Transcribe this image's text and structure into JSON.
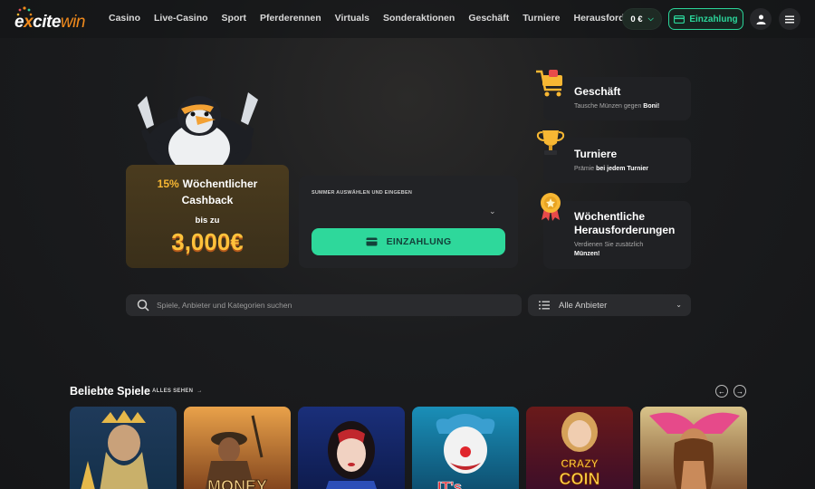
{
  "header": {
    "logo": {
      "part1": "e",
      "part2": "x",
      "part3": "cite",
      "part4": "win"
    },
    "nav": [
      "Casino",
      "Live-Casino",
      "Sport",
      "Pferderennen",
      "Virtuals",
      "Sonderaktionen",
      "Geschäft",
      "Turniere",
      "Herausforderungen"
    ],
    "balance": "0 €",
    "deposit_label": "Einzahlung",
    "icons": [
      "user-icon",
      "menu-icon"
    ]
  },
  "cashback": {
    "percent": "15%",
    "line1": "Wöchentlicher",
    "line2": "Cashback",
    "line3": "bis zu",
    "amount": "3,000€"
  },
  "deposit_panel": {
    "label": "SUMMER AUSWÄHLEN UND EINGEBEN",
    "cta": "EINZAHLUNG"
  },
  "promos": [
    {
      "title": "Geschäft",
      "desc_plain": "Tausche Münzen gegen ",
      "desc_bold": "Boni!",
      "icon": "shopping-cart-icon"
    },
    {
      "title": "Turniere",
      "desc_plain": "Prämie ",
      "desc_bold": "bei jedem Turnier",
      "icon": "trophy-icon"
    },
    {
      "title_l1": "Wöchentliche",
      "title_l2": "Herausforderungen",
      "desc_plain": "Verdienen Sie zusätzlich",
      "desc_bold": "Münzen!",
      "icon": "medal-icon"
    }
  ],
  "search": {
    "placeholder": "Spiele, Anbieter und Kategorien suchen"
  },
  "providers": {
    "selected": "Alle Anbieter"
  },
  "popular": {
    "title": "Beliebte Spiele",
    "see_all": "ALLES SEHEN",
    "games": [
      {
        "name": "zeus-game",
        "text": ""
      },
      {
        "name": "money-train-game",
        "text": "MONEY"
      },
      {
        "name": "snow-white-game",
        "text": ""
      },
      {
        "name": "clown-game",
        "text": "IT's"
      },
      {
        "name": "crazy-coin-flip-game",
        "text_l1": "CRAZY",
        "text_l2": "COIN"
      },
      {
        "name": "tribal-woman-game",
        "text": ""
      }
    ]
  },
  "colors": {
    "accent": "#2ed89b",
    "gold": "#f7b733",
    "brand_orange": "#f08a1c"
  }
}
